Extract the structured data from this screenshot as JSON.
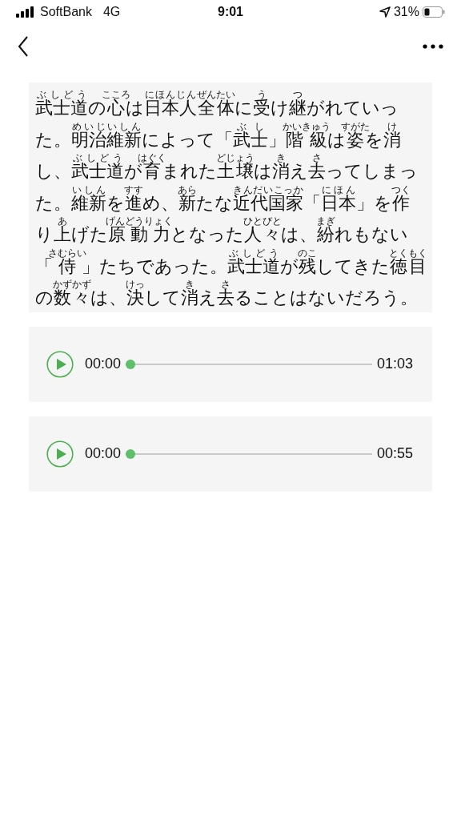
{
  "status_bar": {
    "carrier": "SoftBank",
    "network": "4G",
    "time": "9:01",
    "battery": "31%"
  },
  "passage": [
    [
      {
        "t": "武士道",
        "r": "ぶしどう"
      },
      {
        "t": "の"
      },
      {
        "t": "心",
        "r": "こころ"
      },
      {
        "t": "は"
      },
      {
        "t": "日本人",
        "r": "にほんじん"
      },
      {
        "t": "全体",
        "r": "ぜんたい"
      },
      {
        "t": "に"
      },
      {
        "t": "受",
        "r": "う"
      },
      {
        "t": "け"
      },
      {
        "t": "継",
        "r": "つ"
      },
      {
        "t": "がれていっ"
      }
    ],
    [
      {
        "t": "た。"
      },
      {
        "t": "明治維新",
        "r": "めいじいしん"
      },
      {
        "t": "によって「"
      },
      {
        "t": "武士",
        "r": "ぶし"
      },
      {
        "t": "」"
      },
      {
        "t": "階級",
        "r": "かいきゅう"
      },
      {
        "t": "は"
      },
      {
        "t": "姿",
        "r": "すがた"
      },
      {
        "t": "を"
      },
      {
        "t": "消",
        "r": "け"
      }
    ],
    [
      {
        "t": "し、"
      },
      {
        "t": "武士道",
        "r": "ぶしどう"
      },
      {
        "t": "が"
      },
      {
        "t": "育",
        "r": "はぐく"
      },
      {
        "t": "まれた"
      },
      {
        "t": "土壌",
        "r": "どじょう"
      },
      {
        "t": "は"
      },
      {
        "t": "消",
        "r": "き"
      },
      {
        "t": "え"
      },
      {
        "t": "去",
        "r": "さ"
      },
      {
        "t": "ってしまっ"
      }
    ],
    [
      {
        "t": "た。"
      },
      {
        "t": "維新",
        "r": "いしん"
      },
      {
        "t": "を"
      },
      {
        "t": "進",
        "r": "すす"
      },
      {
        "t": "め、"
      },
      {
        "t": "新",
        "r": "あら"
      },
      {
        "t": "たな"
      },
      {
        "t": "近代国家",
        "r": "きんだいこっか"
      },
      {
        "t": "「"
      },
      {
        "t": "日本",
        "r": "にほん"
      },
      {
        "t": "」を"
      },
      {
        "t": "作",
        "r": "つく"
      }
    ],
    [
      {
        "t": "り"
      },
      {
        "t": "上",
        "r": "あ"
      },
      {
        "t": "げた"
      },
      {
        "t": "原動力",
        "r": "げんどうりょく"
      },
      {
        "t": "となった"
      },
      {
        "t": "人々",
        "r": "ひとびと"
      },
      {
        "t": "は、"
      },
      {
        "t": "紛",
        "r": "まぎ"
      },
      {
        "t": "れもない"
      }
    ],
    [
      {
        "t": "「"
      },
      {
        "t": "侍",
        "r": "さむらい"
      },
      {
        "t": "」たちであった。"
      },
      {
        "t": "武士道",
        "r": "ぶしどう"
      },
      {
        "t": "が"
      },
      {
        "t": "残",
        "r": "のこ"
      },
      {
        "t": "してきた"
      },
      {
        "t": "徳目",
        "r": "とくもく"
      }
    ],
    [
      {
        "t": "の"
      },
      {
        "t": "数々",
        "r": "かずかず"
      },
      {
        "t": "は、"
      },
      {
        "t": "決",
        "r": "けっ"
      },
      {
        "t": "して"
      },
      {
        "t": "消",
        "r": "き"
      },
      {
        "t": "え"
      },
      {
        "t": "去",
        "r": "さ"
      },
      {
        "t": "ることはないだろう。"
      }
    ]
  ],
  "players": [
    {
      "elapsed": "00:00",
      "duration": "01:03",
      "level": 0
    },
    {
      "elapsed": "00:00",
      "duration": "00:55",
      "level": 0
    }
  ]
}
